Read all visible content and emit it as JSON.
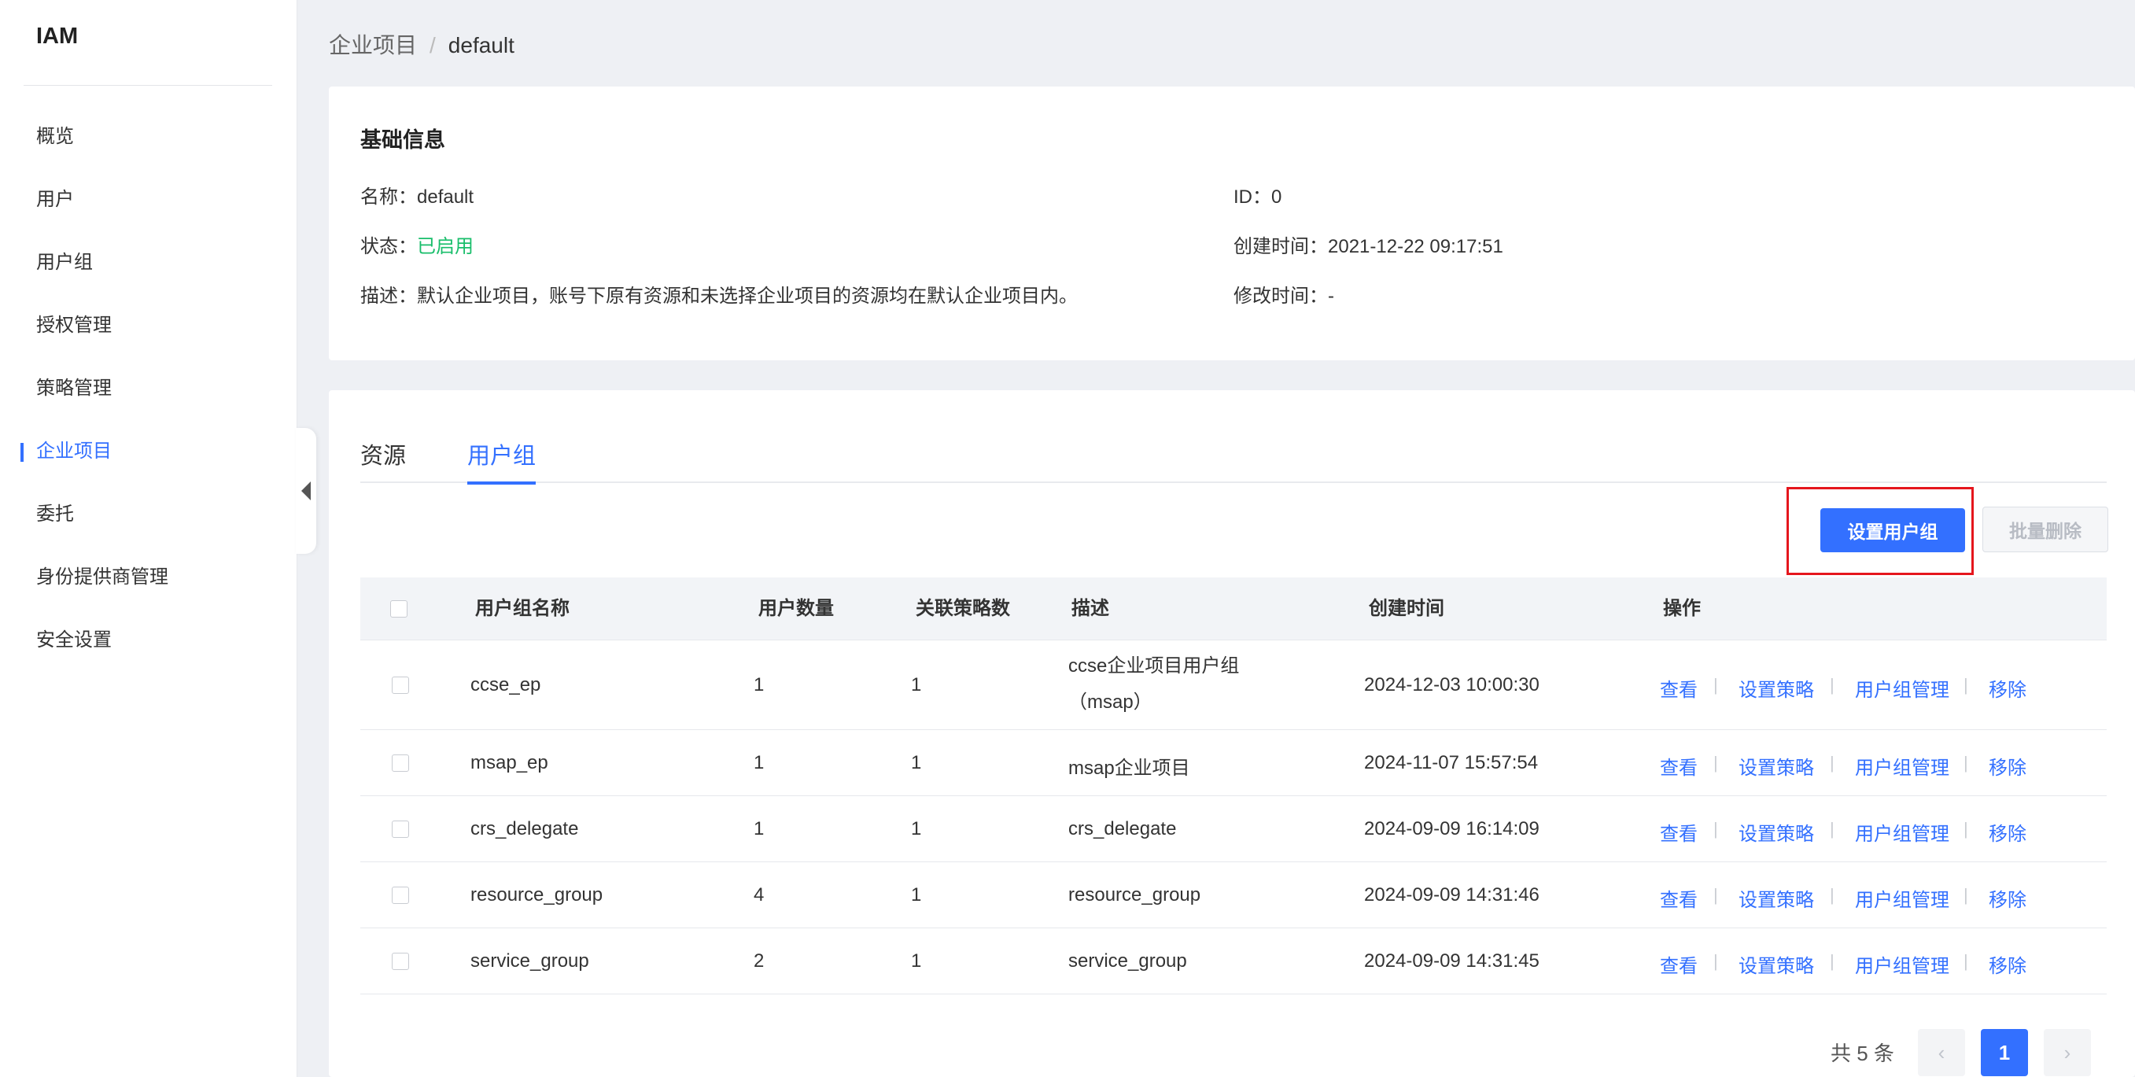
{
  "app": {
    "title": "IAM"
  },
  "sidebar": {
    "items": [
      {
        "label": "概览"
      },
      {
        "label": "用户"
      },
      {
        "label": "用户组"
      },
      {
        "label": "授权管理"
      },
      {
        "label": "策略管理"
      },
      {
        "label": "企业项目",
        "active": true
      },
      {
        "label": "委托"
      },
      {
        "label": "身份提供商管理"
      },
      {
        "label": "安全设置"
      }
    ]
  },
  "breadcrumb": {
    "parent": "企业项目",
    "separator": "/",
    "current": "default"
  },
  "basic_info": {
    "title": "基础信息",
    "name_label": "名称：",
    "name_value": "default",
    "id_label": "ID：",
    "id_value": "0",
    "status_label": "状态：",
    "status_value": "已启用",
    "created_label": "创建时间：",
    "created_value": "2021-12-22 09:17:51",
    "desc_label": "描述：",
    "desc_value": "默认企业项目，账号下原有资源和未选择企业项目的资源均在默认企业项目内。",
    "modified_label": "修改时间：",
    "modified_value": "-"
  },
  "tabs": [
    {
      "label": "资源"
    },
    {
      "label": "用户组",
      "active": true
    }
  ],
  "toolbar": {
    "set_group_label": "设置用户组",
    "batch_delete_label": "批量删除"
  },
  "table": {
    "headers": {
      "name": "用户组名称",
      "user_count": "用户数量",
      "policy_count": "关联策略数",
      "description": "描述",
      "created": "创建时间",
      "actions": "操作"
    },
    "rows": [
      {
        "name": "ccse_ep",
        "user_count": "1",
        "policy_count": "1",
        "description": "ccse企业项目用户组（msap）",
        "created": "2024-12-03 10:00:30"
      },
      {
        "name": "msap_ep",
        "user_count": "1",
        "policy_count": "1",
        "description": "msap企业项目",
        "created": "2024-11-07 15:57:54"
      },
      {
        "name": "crs_delegate",
        "user_count": "1",
        "policy_count": "1",
        "description": "crs_delegate",
        "created": "2024-09-09 16:14:09"
      },
      {
        "name": "resource_group",
        "user_count": "4",
        "policy_count": "1",
        "description": "resource_group",
        "created": "2024-09-09 14:31:46"
      },
      {
        "name": "service_group",
        "user_count": "2",
        "policy_count": "1",
        "description": "service_group",
        "created": "2024-09-09 14:31:45"
      }
    ],
    "actions": {
      "view": "查看",
      "set_policy": "设置策略",
      "group_manage": "用户组管理",
      "remove": "移除",
      "sep": "|"
    }
  },
  "pagination": {
    "total": "共 5 条",
    "current": "1",
    "prev": "‹",
    "next": "›"
  },
  "colors": {
    "accent": "#3370ff",
    "success": "#19be6b",
    "highlight": "#e5161d"
  }
}
